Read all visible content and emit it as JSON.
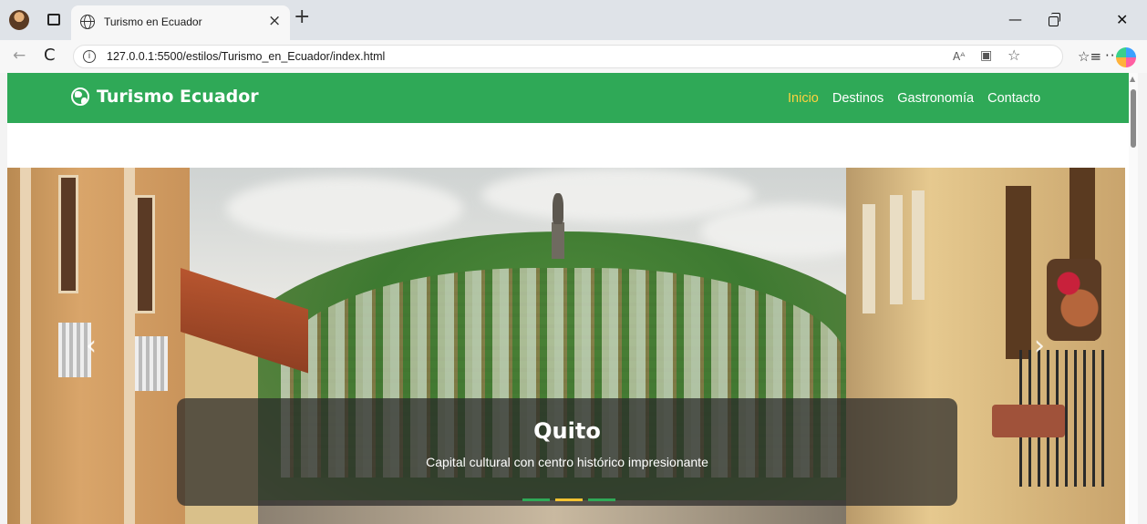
{
  "browser": {
    "tab_title": "Turismo en Ecuador",
    "tab_close": "×",
    "new_tab": "+",
    "url": "127.0.0.1:5500/estilos/Turismo_en_Ecuador/index.html",
    "back_glyph": "←",
    "reload_glyph": "C",
    "info_glyph": "i",
    "read_aloud_glyph": "Aᴬ",
    "immersive_glyph": "▣",
    "favorite_glyph": "☆",
    "favorites_glyph": "☆≡",
    "more_glyph": "···",
    "win_min": "—",
    "win_close": "✕"
  },
  "page": {
    "brand": "Turismo Ecuador",
    "nav": [
      {
        "label": "Inicio",
        "active": true
      },
      {
        "label": "Destinos",
        "active": false
      },
      {
        "label": "Gastronomía",
        "active": false
      },
      {
        "label": "Contacto",
        "active": false
      }
    ],
    "carousel": {
      "title": "Quito",
      "subtitle": "Capital cultural con centro histórico impresionante",
      "prev": "‹",
      "next": "›",
      "slides": 3,
      "active_slide": 2
    }
  },
  "colors": {
    "navbar": "#2fa957",
    "active_link": "#ffd23f",
    "indicator_active": "#f2c232"
  },
  "icons": [
    "profile-avatar-icon",
    "tab-actions-icon",
    "globe-icon",
    "info-icon",
    "read-aloud-icon",
    "immersive-reader-icon",
    "favorite-star-icon",
    "favorites-icon",
    "more-icon",
    "copilot-icon",
    "brand-globe-icon"
  ]
}
